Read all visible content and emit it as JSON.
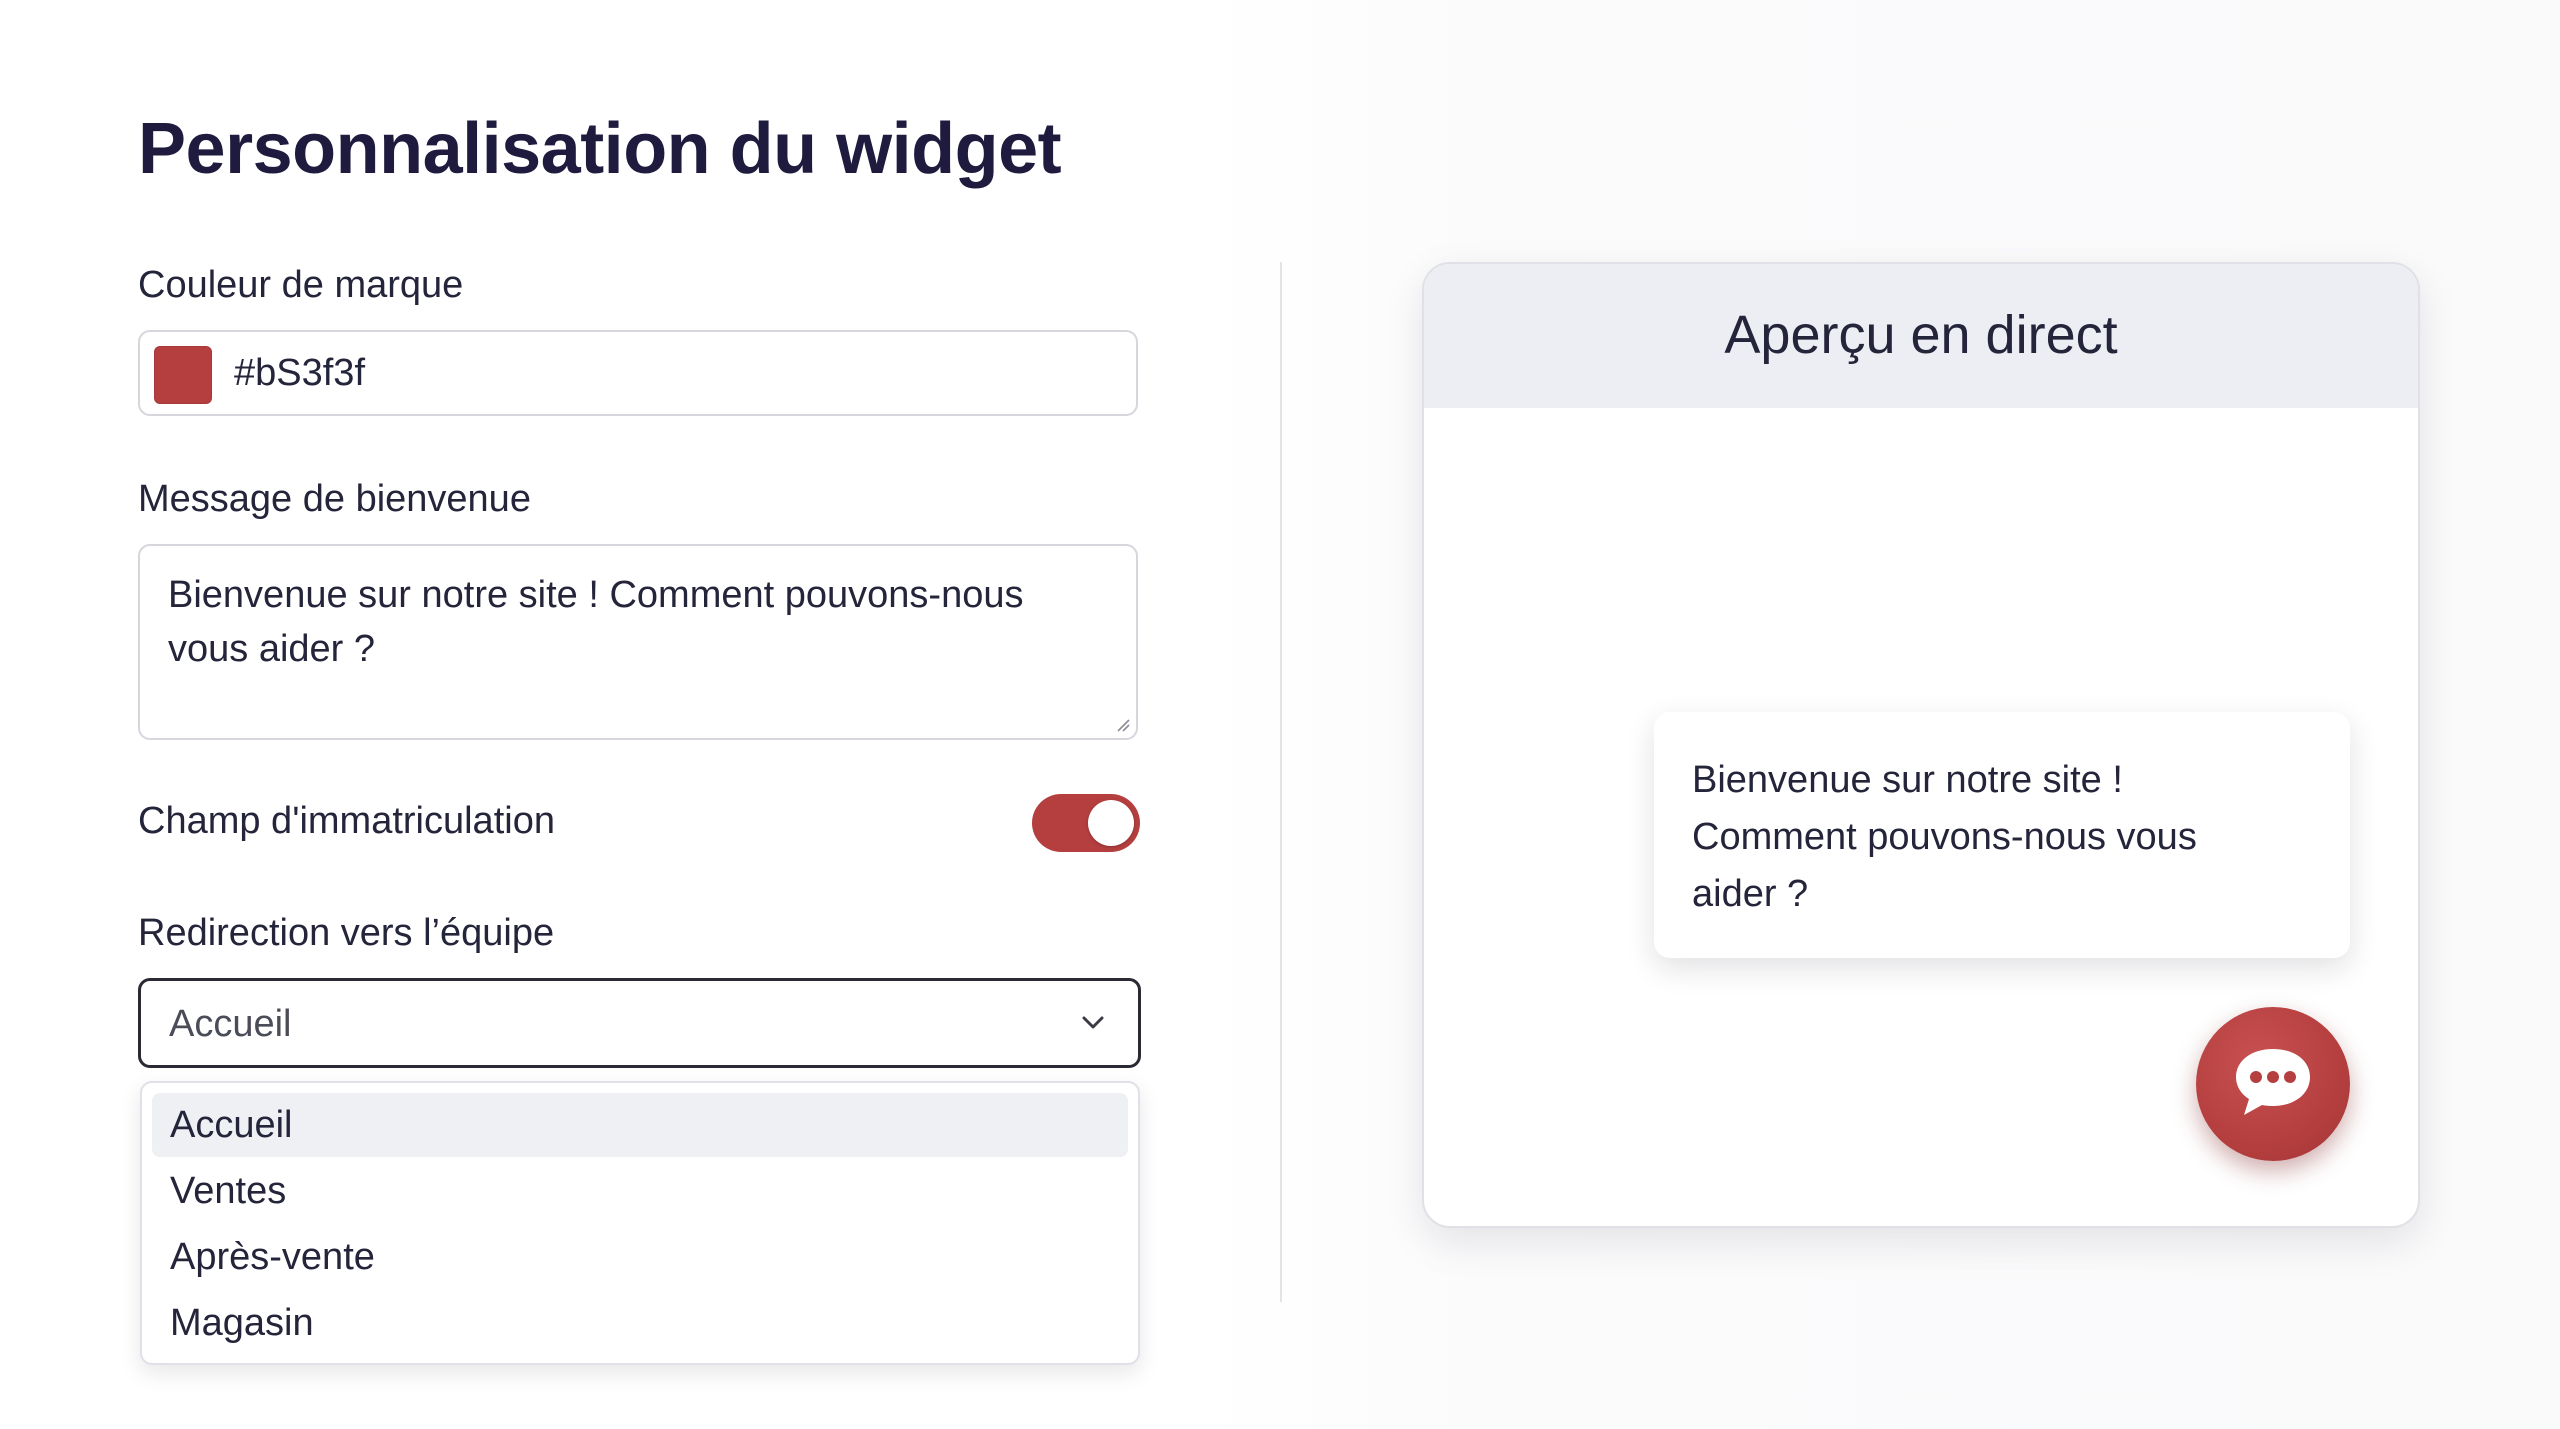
{
  "title": "Personnalisation du widget",
  "colors": {
    "brand": "#b53f3f",
    "title": "#1e1b3e"
  },
  "brand_color": {
    "label": "Couleur de marque",
    "value": "#bS3f3f"
  },
  "welcome_message": {
    "label": "Message de bienvenue",
    "value": "Bienvenue sur notre site ! Comment pouvons-nous vous aider ?"
  },
  "registration_field": {
    "label": "Champ d'immatriculation",
    "enabled": true
  },
  "team_redirect": {
    "label": "Redirection vers l’équipe",
    "selected": "Accueil",
    "options": [
      "Accueil",
      "Ventes",
      "Après-vente",
      "Magasin"
    ]
  },
  "preview": {
    "title": "Aperçu en direct",
    "bubble_line1": "Bienvenue sur notre site !",
    "bubble_line2": "Comment pouvons-nous vous",
    "bubble_line3": "aider ?",
    "chat_button_icon": "chat-bubble-dots-icon"
  }
}
